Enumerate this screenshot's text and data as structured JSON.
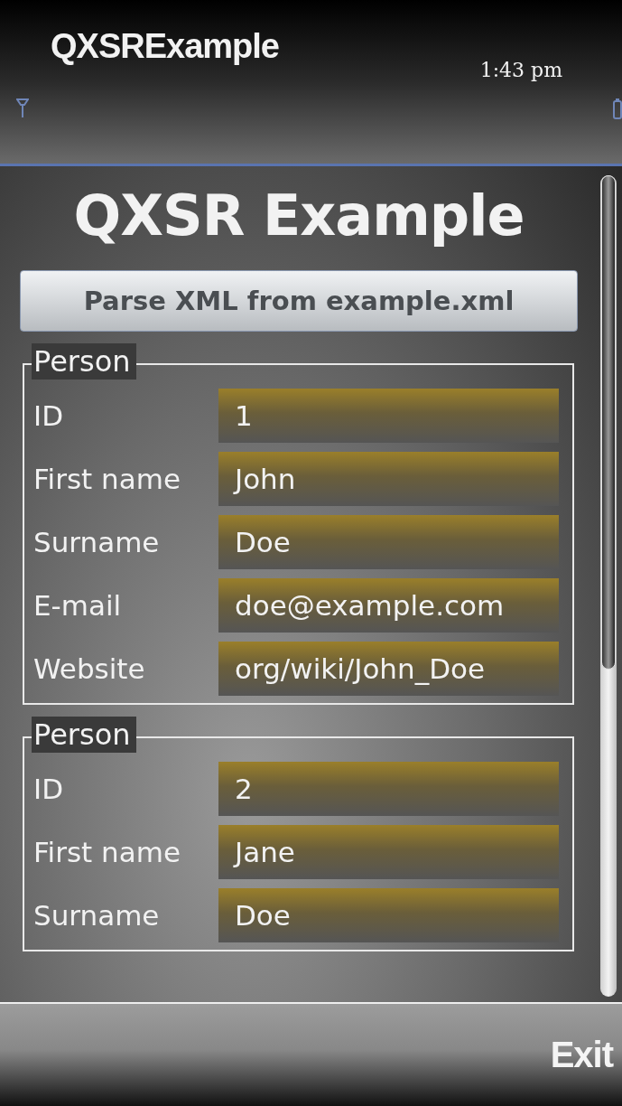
{
  "status_bar": {
    "title": "QXSRExample",
    "time": "1:43 pm"
  },
  "heading": "QXSR Example",
  "parse_button": "Parse XML from example.xml",
  "groups": [
    {
      "title": "Person",
      "fields": [
        {
          "label": "ID",
          "value": "1"
        },
        {
          "label": "First name",
          "value": "John"
        },
        {
          "label": "Surname",
          "value": "Doe"
        },
        {
          "label": "E-mail",
          "value": "doe@example.com"
        },
        {
          "label": "Website",
          "value": "org/wiki/John_Doe"
        }
      ]
    },
    {
      "title": "Person",
      "fields": [
        {
          "label": "ID",
          "value": "2"
        },
        {
          "label": "First name",
          "value": "Jane"
        },
        {
          "label": "Surname",
          "value": "Doe"
        }
      ]
    }
  ],
  "softkeys": {
    "right": "Exit"
  }
}
